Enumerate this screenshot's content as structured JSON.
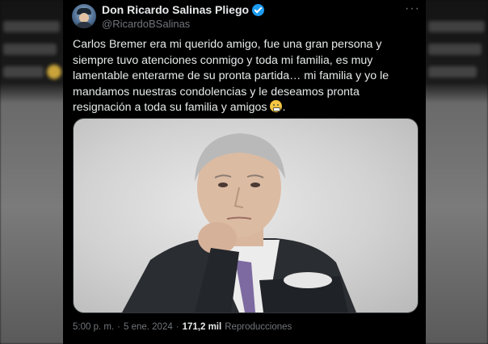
{
  "tweet": {
    "display_name": "Don Ricardo Salinas Pliego",
    "handle": "@RicardoBSalinas",
    "text_main": "Carlos Bremer era mi querido amigo, fue una gran persona y siempre tuvo atenciones conmigo y toda mi familia, es muy lamentable enterarme de su pronta partida… mi familia y yo le mandamos nuestras condolencias y le deseamos pronta resignación a toda su familia y amigos ",
    "text_end": ".",
    "emoji_icon": "weary-face-emoji",
    "more_label": "···",
    "time": "5:00 p. m.",
    "separator": "·",
    "date": "5 ene. 2024",
    "views_count": "171,2 mil",
    "views_label": "Reproducciones",
    "verified_color": "#1d9bf0"
  }
}
